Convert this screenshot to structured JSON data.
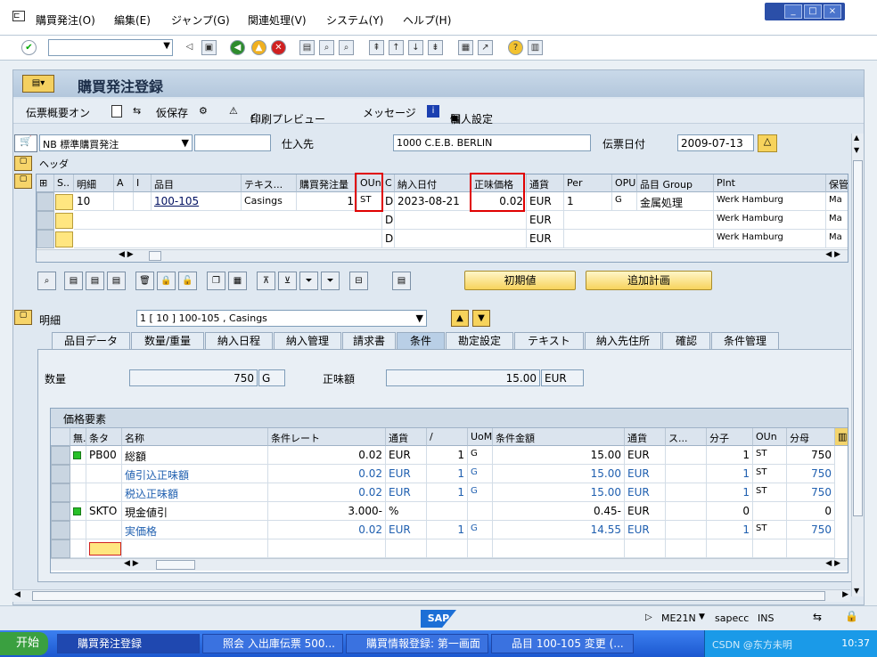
{
  "menu": [
    "購買発注(O)",
    "編集(E)",
    "ジャンプ(G)",
    "関連処理(V)",
    "システム(Y)",
    "ヘルプ(H)"
  ],
  "window_buttons": [
    "_",
    "□",
    "×"
  ],
  "app_title": "購買発注登録",
  "app_toolbar": {
    "doc_overview": "伝票概要オン",
    "hold": "仮保存",
    "print_preview": "印刷プレビュー",
    "messages": "メッセージ",
    "personal_settings": "個人設定"
  },
  "header": {
    "doc_type": "NB 標準購買発注",
    "doc_number": "",
    "vendor_label": "仕入先",
    "vendor_value": "1000 C.E.B. BERLIN",
    "date_label": "伝票日付",
    "date_value": "2009-07-13",
    "header_section": "ヘッダ"
  },
  "items_table": {
    "columns": [
      "S..",
      "明細",
      "A",
      "I",
      "品目",
      "テキス...",
      "購買発注量",
      "OUn",
      "C",
      "納入日付",
      "正味価格",
      "通貨",
      "Per",
      "OPU",
      "品目 Group",
      "Plnt",
      "保管"
    ],
    "rows": [
      {
        "item": "10",
        "material": "100-105",
        "text": "Casings",
        "qty": "1",
        "oun": "ST",
        "c": "D",
        "delivery": "2023-08-21",
        "price": "0.02",
        "currency": "EUR",
        "per": "1",
        "opu": "G",
        "group": "金属処理",
        "plant": "Werk Hamburg",
        "sloc": "Ma"
      },
      {
        "item": "",
        "material": "",
        "text": "",
        "qty": "",
        "oun": "",
        "c": "D",
        "delivery": "",
        "price": "",
        "currency": "EUR",
        "per": "",
        "opu": "",
        "group": "",
        "plant": "Werk Hamburg",
        "sloc": "Ma"
      },
      {
        "item": "",
        "material": "",
        "text": "",
        "qty": "",
        "oun": "",
        "c": "D",
        "delivery": "",
        "price": "",
        "currency": "EUR",
        "per": "",
        "opu": "",
        "group": "",
        "plant": "Werk Hamburg",
        "sloc": "Ma"
      }
    ]
  },
  "buttons": {
    "default_values": "初期値",
    "add_planning": "追加計画"
  },
  "detail": {
    "label": "明細",
    "item_select": "1 [ 10 ] 100-105 , Casings"
  },
  "tabs": [
    "品目データ",
    "数量/重量",
    "納入日程",
    "納入管理",
    "請求書",
    "条件",
    "勘定設定",
    "テキスト",
    "納入先住所",
    "確認",
    "条件管理"
  ],
  "active_tab": "条件",
  "conditions": {
    "qty_label": "数量",
    "qty_value": "750",
    "qty_unit": "G",
    "net_label": "正味額",
    "net_value": "15.00",
    "net_currency": "EUR",
    "section_title": "価格要素",
    "columns": [
      "無.",
      "条タ",
      "名称",
      "条件レート",
      "通貨",
      "/",
      "UoM",
      "条件金額",
      "通貨",
      "ス...",
      "分子",
      "OUn",
      "分母"
    ],
    "rows": [
      {
        "status": "green",
        "type": "PB00",
        "name": "総額",
        "rate": "0.02",
        "cur": "EUR",
        "per": "1",
        "uom": "G",
        "amount": "15.00",
        "cur2": "EUR",
        "num": "1",
        "oun": "ST",
        "den": "750",
        "blue": false
      },
      {
        "status": "",
        "type": "",
        "name": "値引込正味額",
        "rate": "0.02",
        "cur": "EUR",
        "per": "1",
        "uom": "G",
        "amount": "15.00",
        "cur2": "EUR",
        "num": "1",
        "oun": "ST",
        "den": "750",
        "blue": true
      },
      {
        "status": "",
        "type": "",
        "name": "税込正味額",
        "rate": "0.02",
        "cur": "EUR",
        "per": "1",
        "uom": "G",
        "amount": "15.00",
        "cur2": "EUR",
        "num": "1",
        "oun": "ST",
        "den": "750",
        "blue": true
      },
      {
        "status": "green",
        "type": "SKTO",
        "name": "現金値引",
        "rate": "3.000-",
        "cur": "%",
        "per": "",
        "uom": "",
        "amount": "0.45-",
        "cur2": "EUR",
        "num": "0",
        "oun": "",
        "den": "0",
        "blue": false
      },
      {
        "status": "",
        "type": "",
        "name": "実価格",
        "rate": "0.02",
        "cur": "EUR",
        "per": "1",
        "uom": "G",
        "amount": "14.55",
        "cur2": "EUR",
        "num": "1",
        "oun": "ST",
        "den": "750",
        "blue": true
      }
    ]
  },
  "statusbar": {
    "tcode": "ME21N",
    "system": "sapecc",
    "mode": "INS",
    "logo": "SAP"
  },
  "taskbar": {
    "start": "开始",
    "tasks": [
      "購買発注登録",
      "照会 入出庫伝票 500...",
      "購買情報登録: 第一画面",
      "品目 100-105 変更 (..."
    ],
    "clock": "10:37",
    "watermark": "CSDN @东方未明"
  }
}
